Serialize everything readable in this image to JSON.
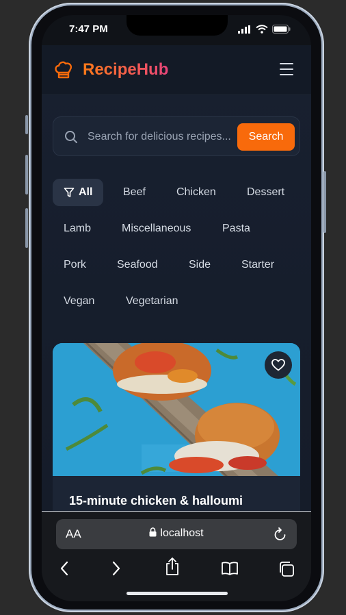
{
  "status_bar": {
    "time": "7:47 PM"
  },
  "header": {
    "app_name": "RecipeHub"
  },
  "search": {
    "placeholder": "Search for delicious recipes...",
    "value": "",
    "button_label": "Search"
  },
  "categories": [
    {
      "label": "All",
      "active": true
    },
    {
      "label": "Beef"
    },
    {
      "label": "Chicken"
    },
    {
      "label": "Dessert"
    },
    {
      "label": "Lamb"
    },
    {
      "label": "Miscellaneous"
    },
    {
      "label": "Pasta"
    },
    {
      "label": "Pork"
    },
    {
      "label": "Seafood"
    },
    {
      "label": "Side"
    },
    {
      "label": "Starter"
    },
    {
      "label": "Vegan"
    },
    {
      "label": "Vegetarian"
    }
  ],
  "recipe_card": {
    "title": "15-minute chicken & halloumi",
    "favorite_icon": "heart-icon"
  },
  "browser": {
    "text_size_label": "AA",
    "host": "localhost"
  },
  "colors": {
    "accent": "#f86a0b",
    "brand_gradient_start": "#ff7a18",
    "brand_gradient_end": "#e8457a",
    "background": "#182030"
  }
}
